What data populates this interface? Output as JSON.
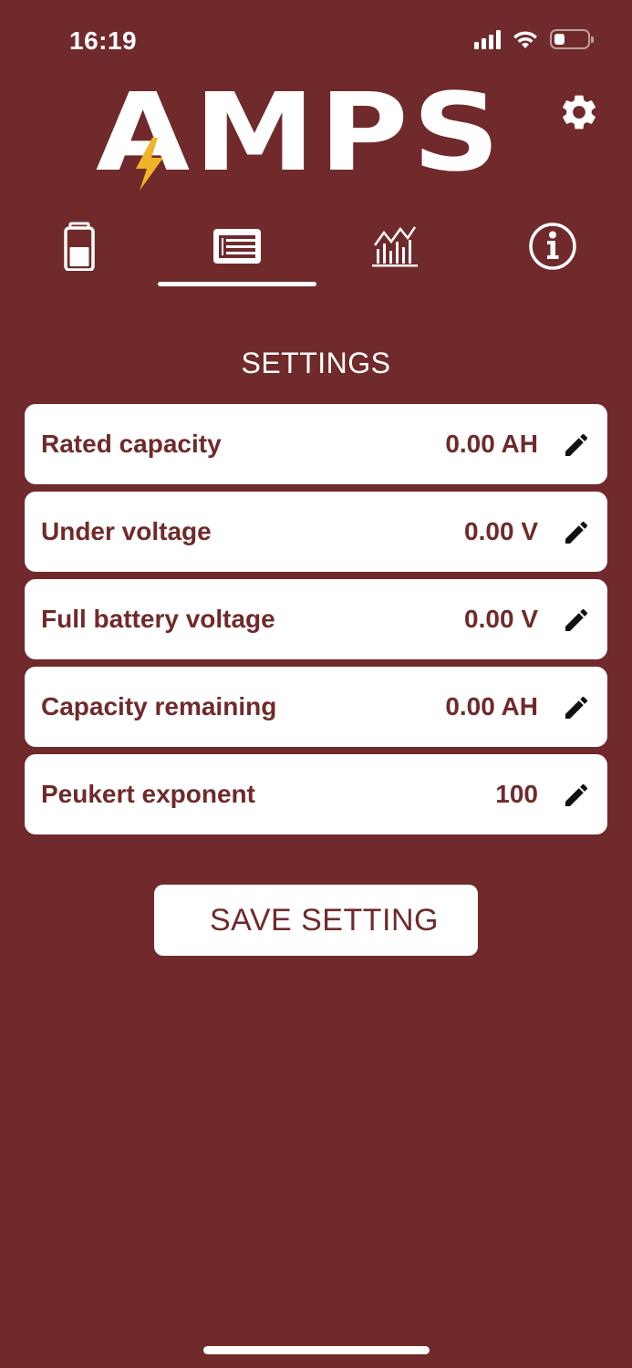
{
  "status_bar": {
    "time": "16:19",
    "icons": [
      "cellular-signal-icon",
      "wifi-icon",
      "battery-icon"
    ]
  },
  "header": {
    "logo_text": "AMPS",
    "logo_accent_color": "#f0b429",
    "settings_icon": "gear-icon"
  },
  "tabs": [
    {
      "name": "battery-tab",
      "icon": "battery-icon",
      "active": false
    },
    {
      "name": "settings-tab",
      "icon": "list-icon",
      "active": true
    },
    {
      "name": "chart-tab",
      "icon": "chart-icon",
      "active": false
    },
    {
      "name": "info-tab",
      "icon": "info-icon",
      "active": false
    }
  ],
  "page": {
    "title": "SETTINGS"
  },
  "settings": [
    {
      "label": "Rated capacity",
      "value": "0.00 AH"
    },
    {
      "label": "Under voltage",
      "value": "0.00 V"
    },
    {
      "label": "Full battery voltage",
      "value": "0.00 V"
    },
    {
      "label": "Capacity remaining",
      "value": "0.00 AH"
    },
    {
      "label": "Peukert exponent",
      "value": "100"
    }
  ],
  "actions": {
    "save_label": "SAVE SETTING"
  },
  "colors": {
    "background": "#702a2b",
    "card": "#ffffff",
    "text_on_card": "#702a2b"
  }
}
